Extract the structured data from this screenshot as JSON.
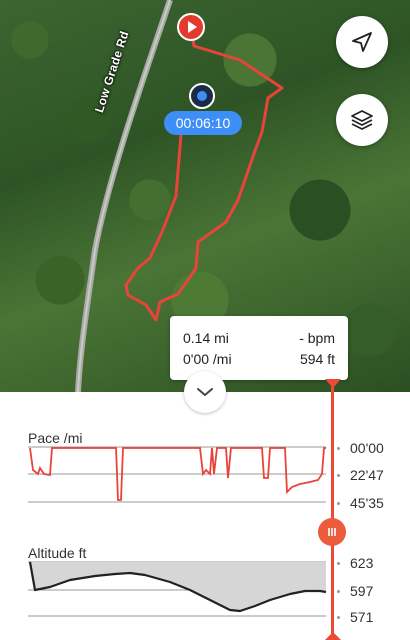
{
  "map": {
    "road_label": "Low Grade Rd",
    "elapsed_time": "00:06:10",
    "buttons": {
      "navigate_icon": "navigation-arrow-icon",
      "layers_icon": "layers-icon"
    }
  },
  "tooltip": {
    "distance": "0.14 mi",
    "heart_rate": "- bpm",
    "pace": "0'00 /mi",
    "altitude": "594 ft"
  },
  "pace_chart": {
    "title": "Pace /mi",
    "ticks": [
      "00'00",
      "22'47",
      "45'35"
    ]
  },
  "altitude_chart": {
    "title": "Altitude ft",
    "ticks": [
      "623",
      "597",
      "571"
    ]
  },
  "colors": {
    "route": "#e8443a",
    "accent": "#ec5b3b",
    "time_pill": "#3d8ef7"
  }
}
